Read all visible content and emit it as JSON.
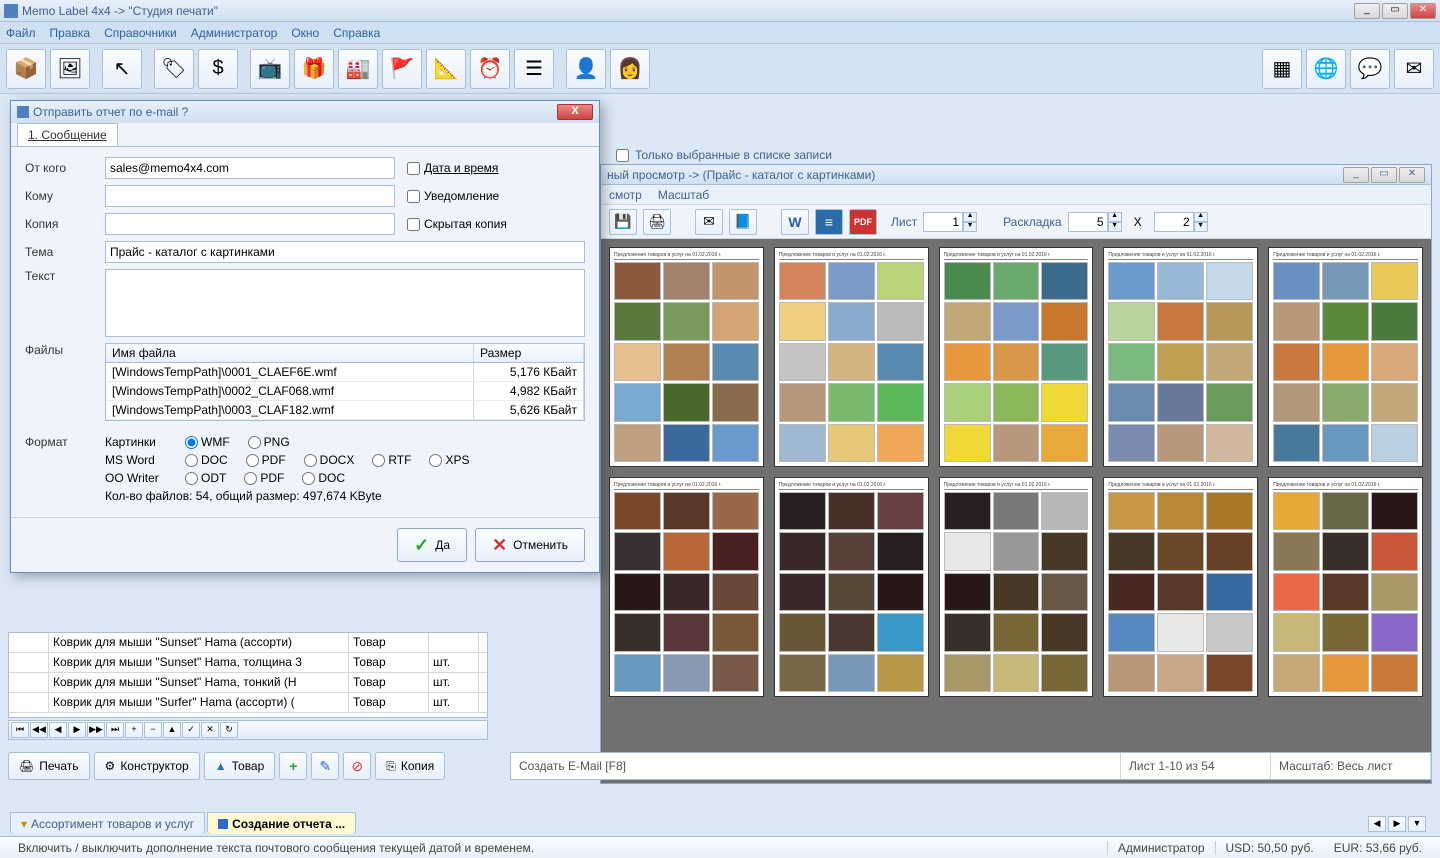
{
  "window": {
    "title": "Memo Label 4x4 -> \"Студия печати\""
  },
  "menu": {
    "file": "Файл",
    "edit": "Правка",
    "refs": "Справочники",
    "admin": "Администратор",
    "window": "Окно",
    "help": "Справка"
  },
  "checkbox_row": {
    "label": "Только выбранные в списке записи"
  },
  "grid": {
    "rows": [
      {
        "name": "Коврик для мыши \"Sunset\" Hama (ассорти)",
        "type": "Товар",
        "unit": ""
      },
      {
        "name": "Коврик для мыши \"Sunset\" Hama, толщина 3",
        "type": "Товар",
        "unit": "шт."
      },
      {
        "name": "Коврик для мыши \"Sunset\" Hama, тонкий (H",
        "type": "Товар",
        "unit": "шт."
      },
      {
        "name": "Коврик для мыши \"Surfer\" Hama (ассорти) (",
        "type": "Товар",
        "unit": "шт."
      }
    ]
  },
  "buttons": {
    "print": "Печать",
    "designer": "Конструктор",
    "product": "Товар",
    "copy": "Копия"
  },
  "subbar": {
    "create": "Создать E-Mail [F8]",
    "pages": "Лист 1-10 из 54",
    "scale": "Масштаб: Весь лист"
  },
  "tabs": {
    "assort": "Ассортимент товаров и услуг",
    "report": "Создание отчета ..."
  },
  "preview": {
    "title": "ный просмотр -> (Прайс - каталог с картинками)",
    "menu": {
      "view": "смотр",
      "scale": "Масштаб"
    },
    "sheet_label": "Лист",
    "sheet_val": "1",
    "layout_label": "Раскладка",
    "layout_cols": "5",
    "layout_x": "X",
    "layout_rows": "2"
  },
  "dialog": {
    "title": "Отправить отчет по e-mail ?",
    "tab": "1. Сообщение",
    "from_lbl": "От кого",
    "from_val": "sales@memo4x4.com",
    "datetime": "Дата и время",
    "to_lbl": "Кому",
    "notify": "Уведомление",
    "cc_lbl": "Копия",
    "bcc": "Скрытая копия",
    "subj_lbl": "Тема",
    "subj_val": "Прайс - каталог с картинками",
    "text_lbl": "Текст",
    "files_lbl": "Файлы",
    "col_name": "Имя файла",
    "col_size": "Размер",
    "files": [
      {
        "name": "[WindowsTempPath]\\0001_CLAEF6E.wmf",
        "size": "5,176 КБайт"
      },
      {
        "name": "[WindowsTempPath]\\0002_CLAF068.wmf",
        "size": "4,982 КБайт"
      },
      {
        "name": "[WindowsTempPath]\\0003_CLAF182.wmf",
        "size": "5,626 КБайт"
      }
    ],
    "fmt_lbl": "Формат",
    "fmt_pic": "Картинки",
    "fmt_wmf": "WMF",
    "fmt_png": "PNG",
    "fmt_word": "MS Word",
    "fmt_doc": "DOC",
    "fmt_pdf": "PDF",
    "fmt_docx": "DOCX",
    "fmt_rtf": "RTF",
    "fmt_xps": "XPS",
    "fmt_oo": "OO Writer",
    "fmt_odt": "ODT",
    "fmt_pdf2": "PDF",
    "fmt_doc2": "DOC",
    "summary": "Кол-во файлов: 54, общий размер: 497,674 KByte",
    "yes": "Да",
    "cancel": "Отменить"
  },
  "status": {
    "hint": "Включить / выключить дополнение текста почтового сообщения текущей датой и временем.",
    "admin": "Администратор",
    "usd": "USD: 50,50 руб.",
    "eur": "EUR: 53,66 руб."
  },
  "thumb_colors": [
    [
      "#8b5a3c",
      "#a0826d",
      "#c2956e",
      "#5a7a3c",
      "#7a9a5c",
      "#d4a574",
      "#e8c090",
      "#b08050",
      "#5a8ab0",
      "#7aaad0",
      "#4a6a2c",
      "#8a6a4c",
      "#c0a080",
      "#3a6a9c",
      "#6a9acc"
    ],
    [
      "#d4845c",
      "#7a9ac8",
      "#b8d478",
      "#f0d080",
      "#8aaad0",
      "#bababc",
      "#c4c4c4",
      "#d4b480",
      "#5a8ab0",
      "#b8987c",
      "#7aba6c",
      "#5ab858",
      "#a0b8d0",
      "#e8c878",
      "#f0a858"
    ],
    [
      "#4a8a4c",
      "#6aaa6c",
      "#3a6a8c",
      "#c0a878",
      "#7a9ac8",
      "#c8782c",
      "#e8983c",
      "#d8984c",
      "#58987c",
      "#aad07a",
      "#8ab858",
      "#f0d838",
      "#f0d838",
      "#b8987c",
      "#e8a83c"
    ],
    [
      "#6a9acc",
      "#98b8d8",
      "#c4d8e8",
      "#b8d49c",
      "#c8783c",
      "#b89858",
      "#7aba7c",
      "#c0a050",
      "#c0a878",
      "#6a8ab0",
      "#687898",
      "#6a9a5c",
      "#7a8ab0",
      "#b8987c",
      "#d0b89c"
    ],
    [
      "#6890c0",
      "#7898b8",
      "#e8c858",
      "#b89878",
      "#5a8a3c",
      "#4a7a3c",
      "#c8783c",
      "#e8983c",
      "#d8a878",
      "#b09878",
      "#8aaa6c",
      "#c0a878",
      "#48789c",
      "#6898c0",
      "#b8d0e0"
    ],
    [
      "#784828",
      "#583828",
      "#986848",
      "#383030",
      "#b86838",
      "#482020",
      "#281818",
      "#382828",
      "#684838",
      "#383028",
      "#583838",
      "#785838",
      "#6898c0",
      "#8898b0",
      "#785848"
    ],
    [
      "#282020",
      "#483028",
      "#684040",
      "#382828",
      "#584038",
      "#282020",
      "#382828",
      "#584838",
      "#281818",
      "#685838",
      "#483830",
      "#3898c8",
      "#786848",
      "#7898b8",
      "#b89848"
    ],
    [
      "#282020",
      "#787878",
      "#b8b8b8",
      "#e8e8e8",
      "#989898",
      "#483828",
      "#281818",
      "#483828",
      "#685848",
      "#383028",
      "#786838",
      "#483828",
      "#a89868",
      "#c8b878",
      "#786838"
    ],
    [
      "#c89848",
      "#b88838",
      "#a87828",
      "#483828",
      "#684828",
      "#684028",
      "#482820",
      "#583828",
      "#3868a0",
      "#5888c0",
      "#e8e8e8",
      "#c8c8c8",
      "#b89878",
      "#c8a888",
      "#784828"
    ],
    [
      "#e8a838",
      "#686848",
      "#281818",
      "#887858",
      "#383028",
      "#c85838",
      "#e86848",
      "#583828",
      "#a89868",
      "#c8b878",
      "#786838",
      "#8868c8",
      "#c8a878",
      "#e8983c",
      "#c87838"
    ]
  ]
}
